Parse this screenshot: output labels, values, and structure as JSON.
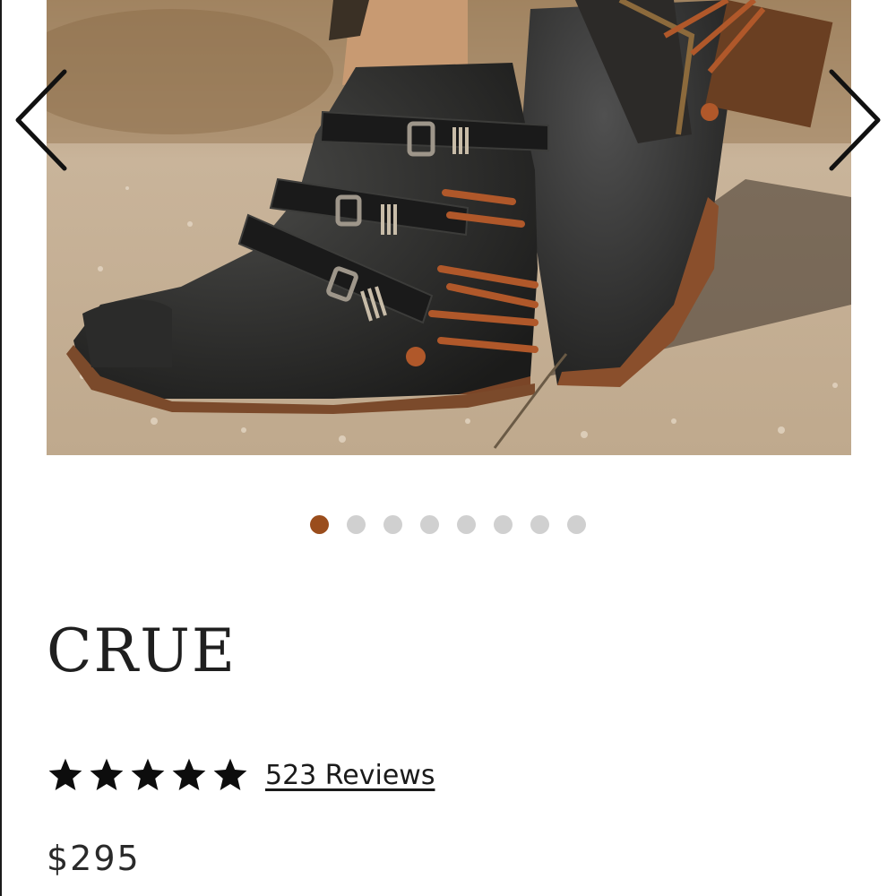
{
  "gallery": {
    "image_subject": "boot-photo",
    "prev_icon": "chevron-left-icon",
    "next_icon": "chevron-right-icon",
    "slide_count": 8,
    "active_slide": 1,
    "dot_active_color": "#9a4d1c",
    "dot_inactive_color": "#d0d0d0"
  },
  "product": {
    "title": "CRUE",
    "rating": 5,
    "rating_max": 5,
    "star_icon": "star-icon",
    "reviews_label": "523 Reviews",
    "price": "$295"
  }
}
